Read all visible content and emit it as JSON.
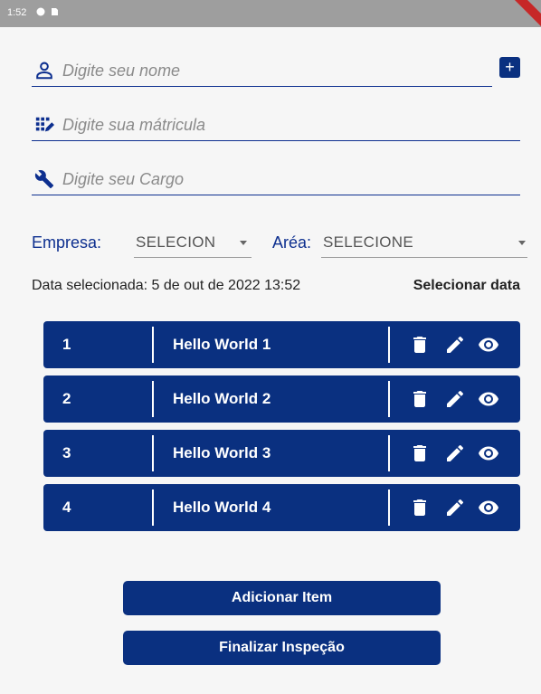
{
  "status_bar": {
    "time": "1:52"
  },
  "form": {
    "name": {
      "placeholder": "Digite seu nome",
      "value": ""
    },
    "matricula": {
      "placeholder": "Digite sua mátricula",
      "value": ""
    },
    "cargo": {
      "placeholder": "Digite seu Cargo",
      "value": ""
    },
    "add_button_label": "+"
  },
  "selects": {
    "empresa_label": "Empresa:",
    "empresa_value": "SELECION",
    "area_label": "Aréa:",
    "area_value": "SELECIONE"
  },
  "date": {
    "text": "Data selecionada: 5 de out de 2022 13:52",
    "button_label": "Selecionar data"
  },
  "items": [
    {
      "num": "1",
      "title": "Hello World 1"
    },
    {
      "num": "2",
      "title": "Hello World 2"
    },
    {
      "num": "3",
      "title": "Hello World 3"
    },
    {
      "num": "4",
      "title": "Hello World 4"
    }
  ],
  "actions": {
    "add_item_label": "Adicionar Item",
    "finish_label": "Finalizar Inspeção"
  },
  "colors": {
    "primary": "#0a3080",
    "underline": "#0d2f8f",
    "background": "#f6f6f6",
    "statusbar": "#9e9e9e"
  },
  "icons": [
    "person-icon",
    "dialpad-icon",
    "wrench-icon",
    "plus-icon",
    "dropdown-caret-icon",
    "delete-icon",
    "edit-icon",
    "view-icon"
  ]
}
